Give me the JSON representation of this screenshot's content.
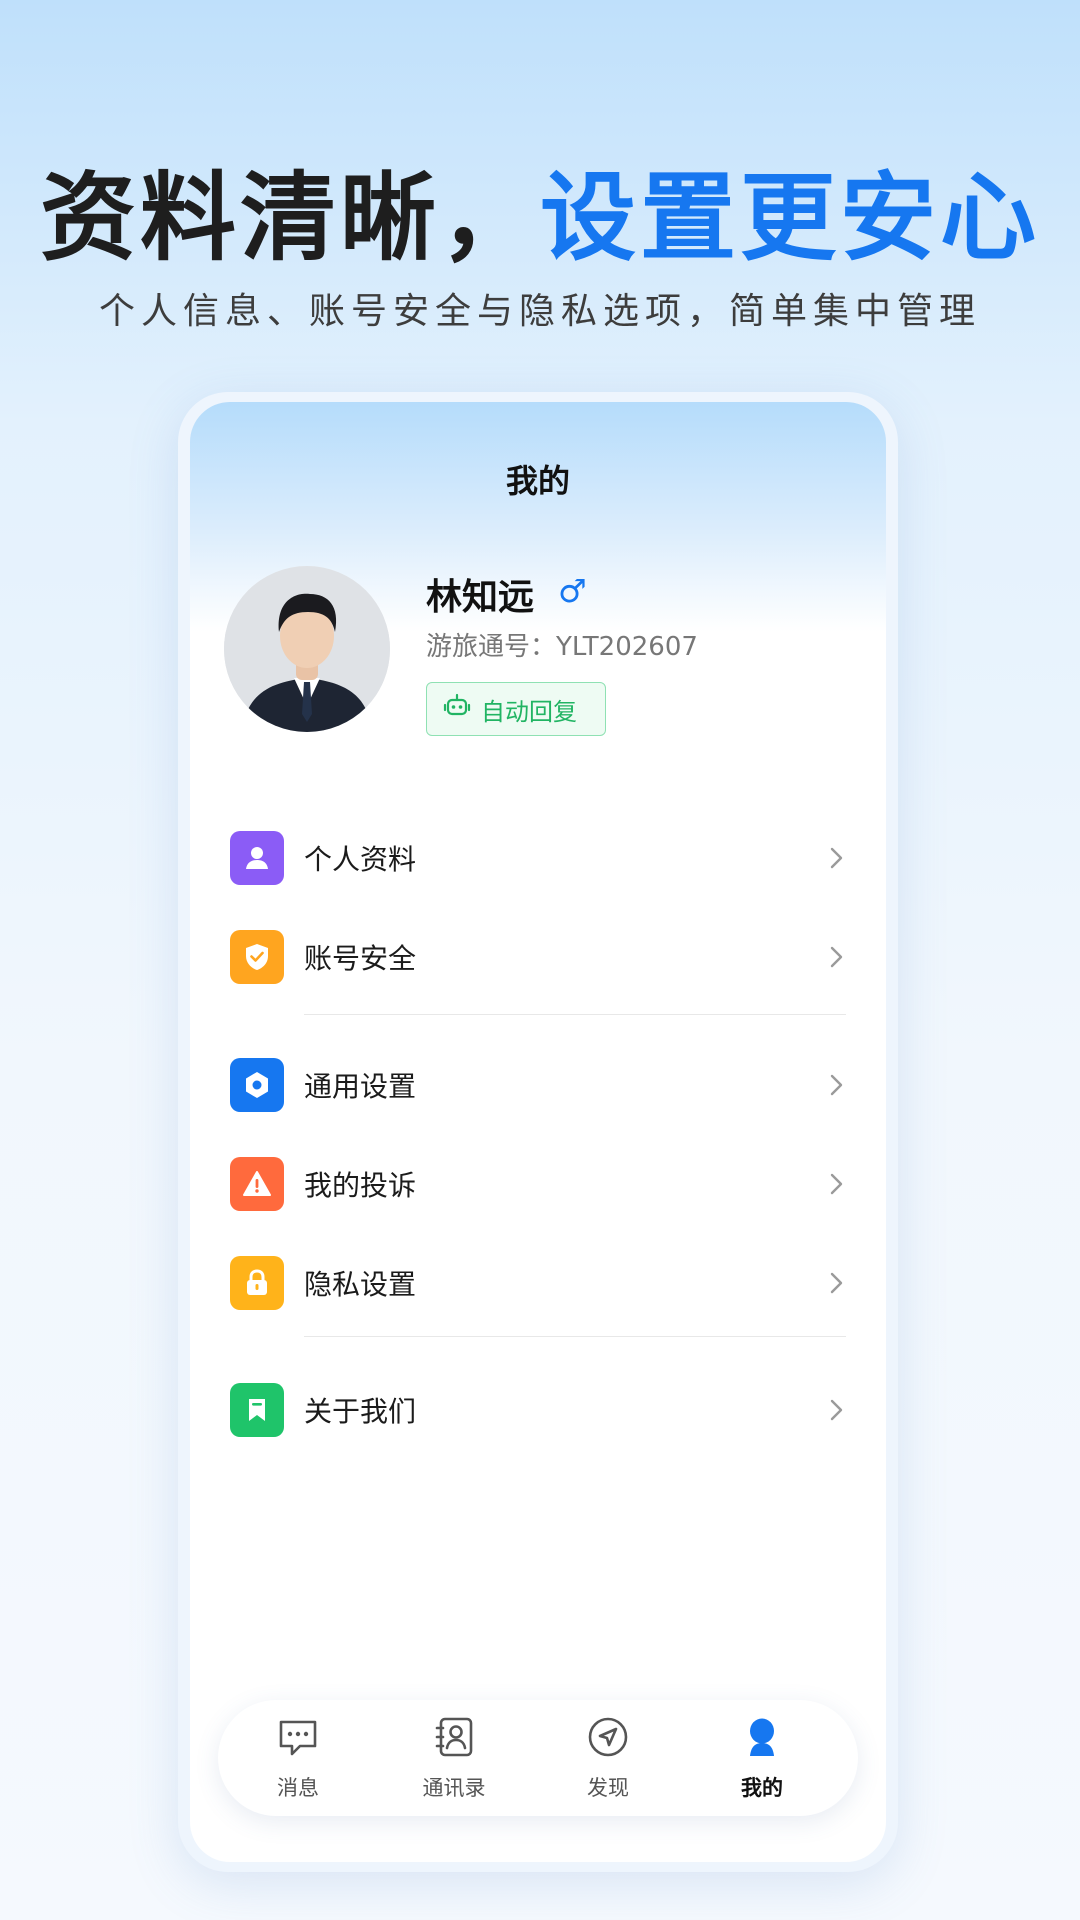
{
  "hero": {
    "title_dark": "资料清晰，",
    "title_accent": "设置更安心",
    "subtitle": "个人信息、账号安全与隐私选项，简单集中管理"
  },
  "header": {
    "title": "我的"
  },
  "profile": {
    "name": "林知远",
    "gender_icon": "male-icon",
    "id_text": "游旅通号：YLT202607",
    "auto_reply_label": "自动回复"
  },
  "menu": {
    "items": [
      {
        "label": "个人资料",
        "icon": "person-icon",
        "color": "#8b5cf6"
      },
      {
        "label": "账号安全",
        "icon": "shield-check-icon",
        "color": "#ffa51f"
      },
      {
        "label": "通用设置",
        "icon": "hexagon-settings-icon",
        "color": "#1677f0"
      },
      {
        "label": "我的投诉",
        "icon": "warning-icon",
        "color": "#ff6a3d"
      },
      {
        "label": "隐私设置",
        "icon": "lock-icon",
        "color": "#ffb31a"
      },
      {
        "label": "关于我们",
        "icon": "bookmark-icon",
        "color": "#1fc46a"
      }
    ]
  },
  "tabbar": {
    "tabs": [
      {
        "label": "消息",
        "icon": "chat-bubble-icon",
        "active": false
      },
      {
        "label": "通讯录",
        "icon": "contacts-icon",
        "active": false
      },
      {
        "label": "发现",
        "icon": "compass-icon",
        "active": false
      },
      {
        "label": "我的",
        "icon": "person-filled-icon",
        "active": true
      }
    ]
  },
  "colors": {
    "accent": "#1677f0",
    "auto_reply_green": "#21b463"
  }
}
